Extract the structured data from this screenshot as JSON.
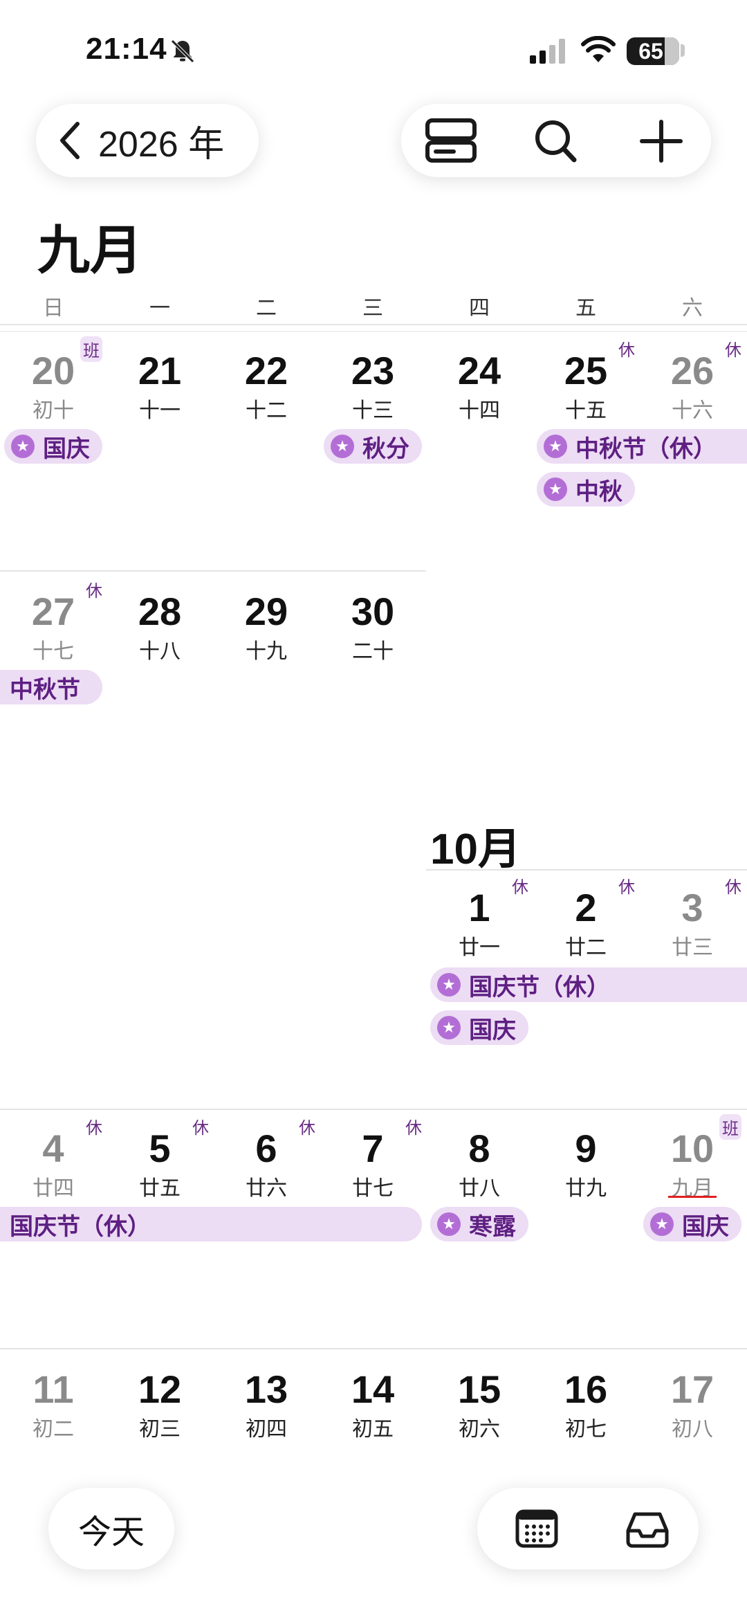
{
  "status_bar": {
    "time": "21:14",
    "battery": "65",
    "battery_level": 0.65
  },
  "header": {
    "year_label": "2026 年"
  },
  "september": {
    "title": "九月",
    "weekdays": [
      "日",
      "一",
      "二",
      "三",
      "四",
      "五",
      "六"
    ],
    "week1": [
      {
        "day": "20",
        "lunar": "初十",
        "badge": "班"
      },
      {
        "day": "21",
        "lunar": "十一"
      },
      {
        "day": "22",
        "lunar": "十二"
      },
      {
        "day": "23",
        "lunar": "十三"
      },
      {
        "day": "24",
        "lunar": "十四"
      },
      {
        "day": "25",
        "lunar": "十五",
        "badge": "休"
      },
      {
        "day": "26",
        "lunar": "十六",
        "badge": "休"
      }
    ],
    "week1_events": [
      "国庆",
      "秋分",
      "中秋节（休）",
      "中秋"
    ],
    "week2": [
      {
        "day": "27",
        "lunar": "十七",
        "badge": "休"
      },
      {
        "day": "28",
        "lunar": "十八"
      },
      {
        "day": "29",
        "lunar": "十九"
      },
      {
        "day": "30",
        "lunar": "二十"
      }
    ],
    "week2_events": [
      "中秋节"
    ]
  },
  "october": {
    "title": "10月",
    "week1": [
      {
        "day": "1",
        "lunar": "廿一",
        "badge": "休"
      },
      {
        "day": "2",
        "lunar": "廿二",
        "badge": "休"
      },
      {
        "day": "3",
        "lunar": "廿三",
        "badge": "休"
      }
    ],
    "week1_events": [
      "国庆节（休）",
      "国庆"
    ],
    "week2": [
      {
        "day": "4",
        "lunar": "廿四",
        "badge": "休"
      },
      {
        "day": "5",
        "lunar": "廿五",
        "badge": "休"
      },
      {
        "day": "6",
        "lunar": "廿六",
        "badge": "休"
      },
      {
        "day": "7",
        "lunar": "廿七",
        "badge": "休"
      },
      {
        "day": "8",
        "lunar": "廿八"
      },
      {
        "day": "9",
        "lunar": "廿九"
      },
      {
        "day": "10",
        "lunar": "九月",
        "badge": "班"
      }
    ],
    "week2_events": [
      "国庆节（休）",
      "寒露",
      "国庆"
    ],
    "week3": [
      {
        "day": "11",
        "lunar": "初二"
      },
      {
        "day": "12",
        "lunar": "初三"
      },
      {
        "day": "13",
        "lunar": "初四"
      },
      {
        "day": "14",
        "lunar": "初五"
      },
      {
        "day": "15",
        "lunar": "初六"
      },
      {
        "day": "16",
        "lunar": "初七"
      },
      {
        "day": "17",
        "lunar": "初八"
      }
    ]
  },
  "bottom": {
    "today_label": "今天"
  },
  "colors": {
    "event_bg": "#ecdcf4",
    "event_text": "#5e1f82",
    "star": "#b36ed6",
    "badge": "#6a2d86",
    "today_underline": "#e02020"
  }
}
